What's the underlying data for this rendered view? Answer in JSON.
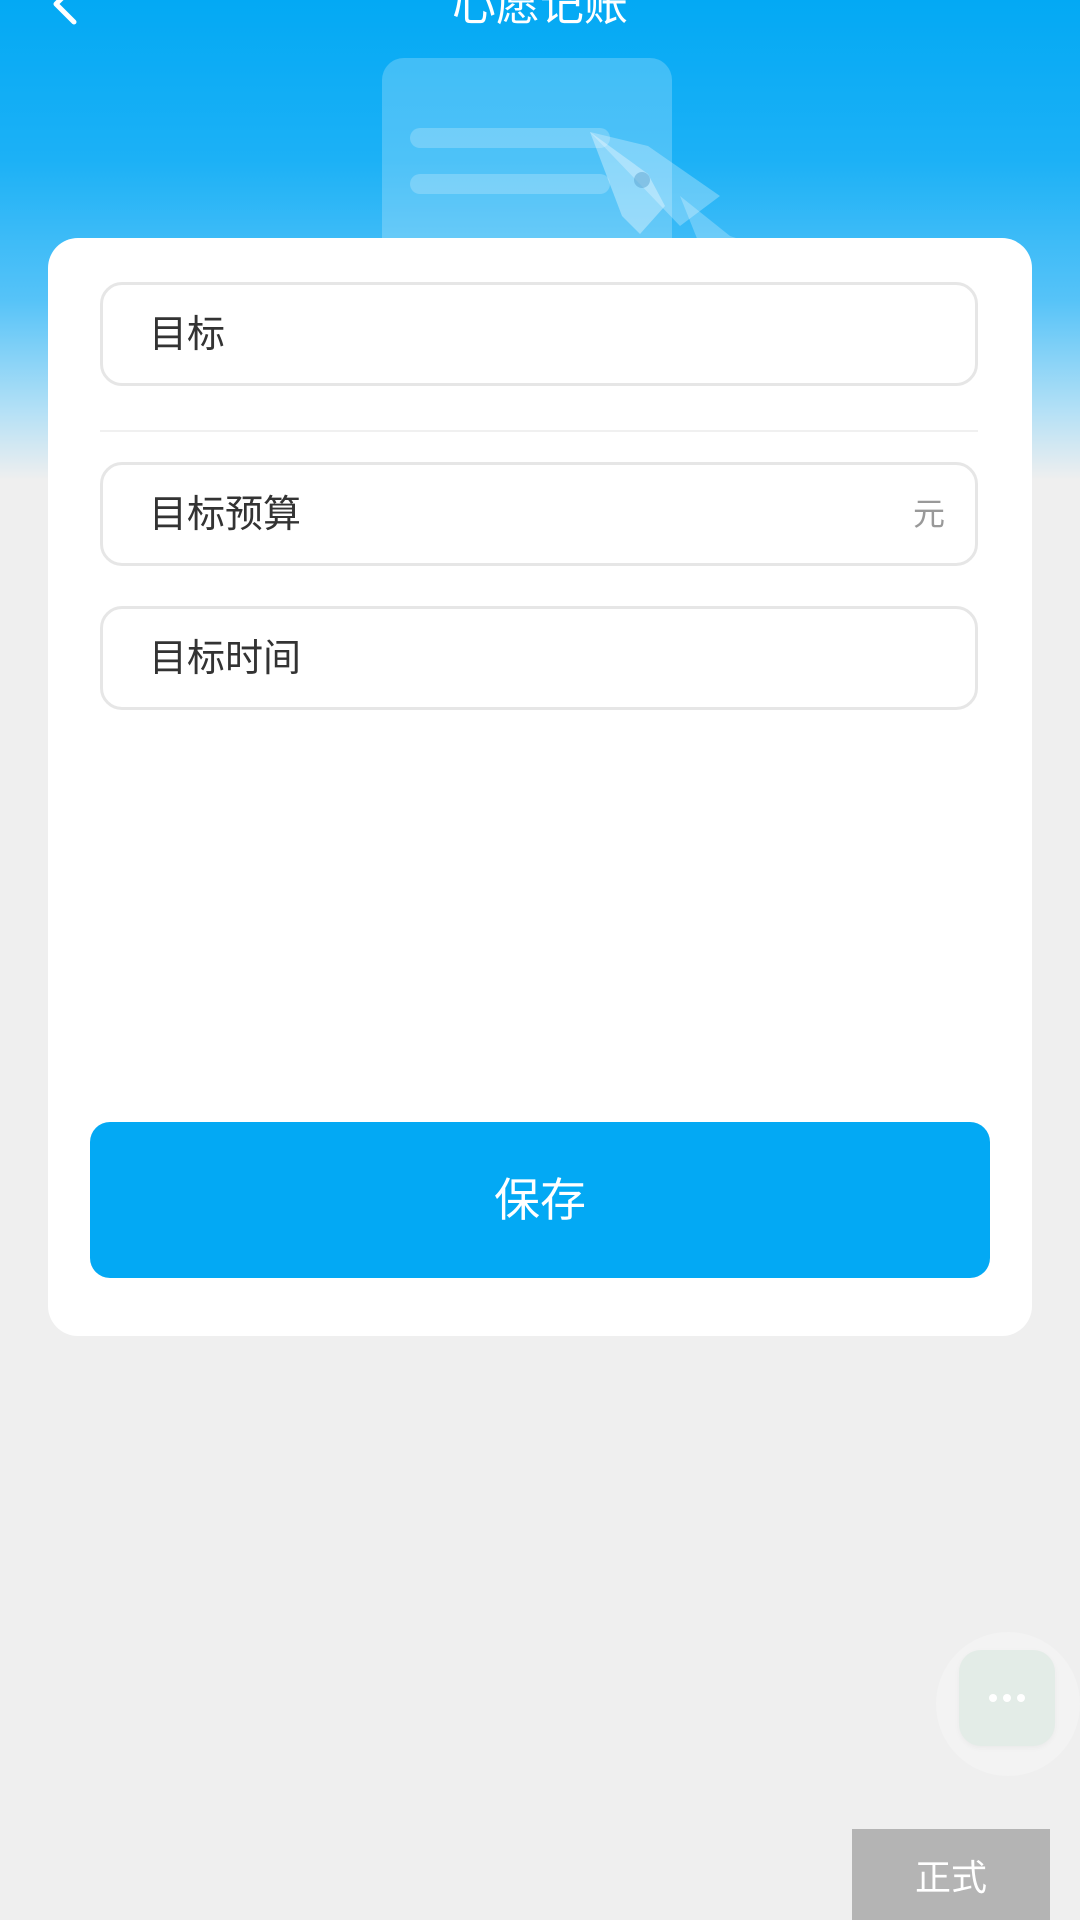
{
  "header": {
    "title": "心愿记账",
    "back_icon": "chevron-left-icon",
    "illustration": "document-pen-illustration"
  },
  "form": {
    "goal_placeholder": "目标",
    "budget_placeholder": "目标预算",
    "budget_unit": "元",
    "time_placeholder": "目标时间"
  },
  "actions": {
    "save_label": "保存"
  },
  "floating": {
    "icon": "more-dots-icon"
  },
  "badge": {
    "env_label": "正式"
  },
  "colors": {
    "primary": "#03a9f4",
    "background": "#efefef",
    "card": "#ffffff",
    "badge": "#b4b4b4"
  }
}
